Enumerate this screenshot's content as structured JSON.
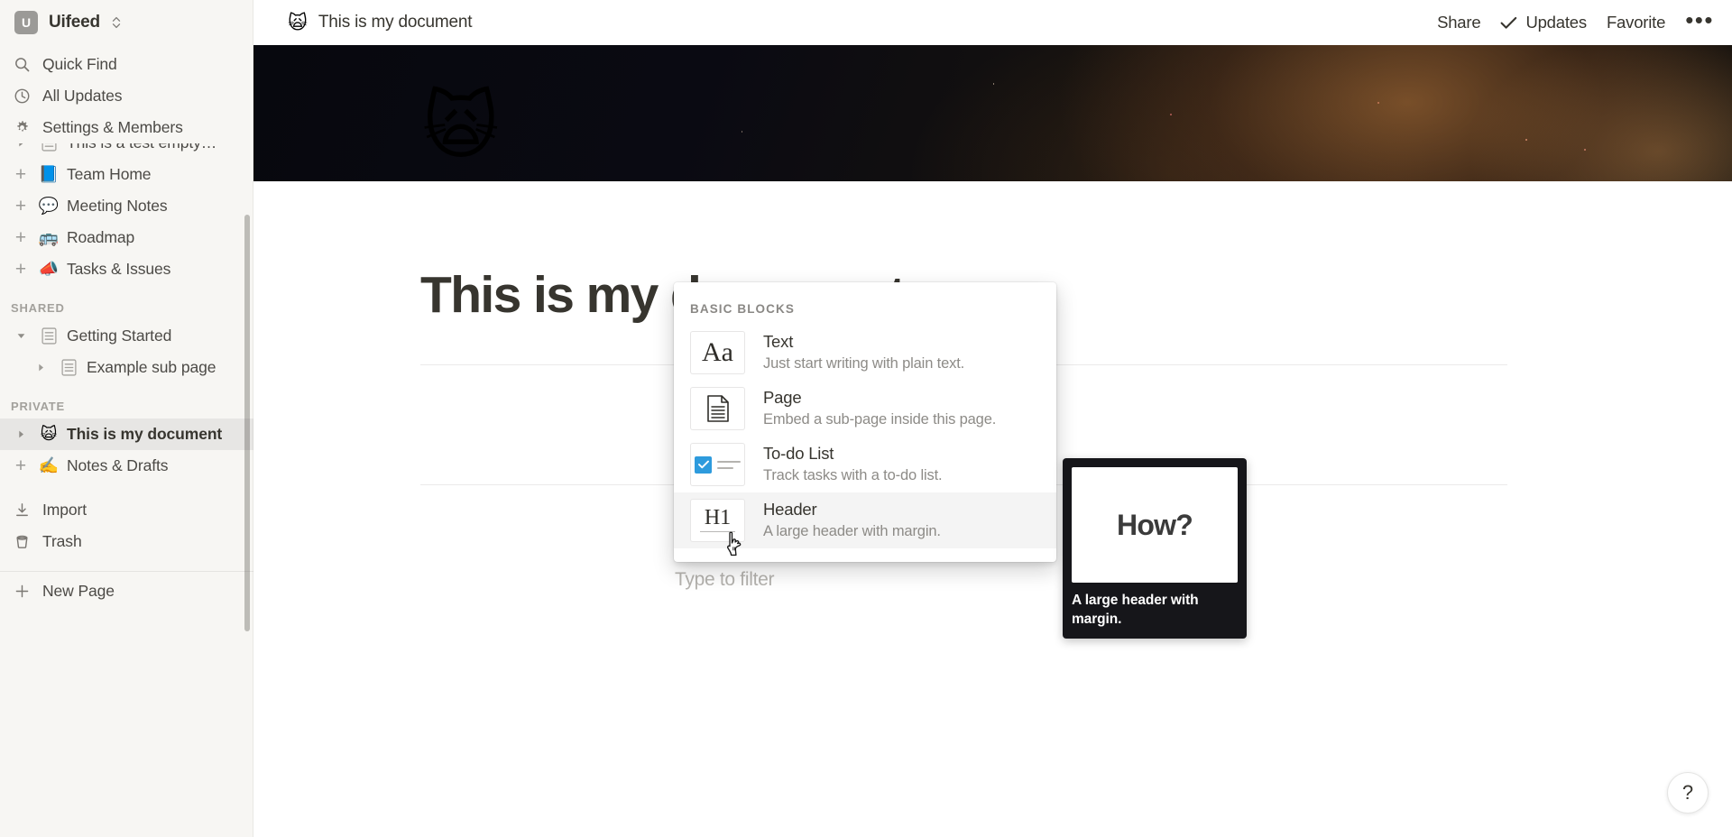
{
  "workspace": {
    "avatar_letter": "U",
    "name": "Uifeed",
    "switcher_icon": "chevron-updown-icon"
  },
  "sidebar": {
    "nav": [
      {
        "icon": "search-icon",
        "label": "Quick Find"
      },
      {
        "icon": "clock-icon",
        "label": "All Updates"
      },
      {
        "icon": "gear-icon",
        "label": "Settings & Members"
      }
    ],
    "tree": [
      {
        "type": "page",
        "toggle": "triangle-right",
        "icon_kind": "doc",
        "emoji": "",
        "label": "This is a test empty…",
        "selected": false,
        "clipped": true
      },
      {
        "type": "page",
        "toggle": "plus",
        "icon_kind": "emoji",
        "emoji": "📘",
        "label": "Team Home",
        "selected": false
      },
      {
        "type": "page",
        "toggle": "plus",
        "icon_kind": "emoji",
        "emoji": "💬",
        "label": "Meeting Notes",
        "selected": false
      },
      {
        "type": "page",
        "toggle": "plus",
        "icon_kind": "emoji",
        "emoji": "🚌",
        "label": "Roadmap",
        "selected": false
      },
      {
        "type": "page",
        "toggle": "plus",
        "icon_kind": "emoji",
        "emoji": "📣",
        "label": "Tasks & Issues",
        "selected": false
      }
    ],
    "section_shared": "SHARED",
    "shared": [
      {
        "toggle": "triangle-down",
        "icon_kind": "doc",
        "label": "Getting Started",
        "indent": 0,
        "selected": false
      },
      {
        "toggle": "triangle-right",
        "icon_kind": "doc",
        "label": "Example sub page",
        "indent": 1,
        "selected": false
      }
    ],
    "section_private": "PRIVATE",
    "private": [
      {
        "toggle": "triangle-right",
        "icon_kind": "emoji",
        "emoji": "🙀",
        "label": "This is my document",
        "indent": 0,
        "selected": true
      },
      {
        "toggle": "plus",
        "icon_kind": "emoji",
        "emoji": "✍️",
        "label": "Notes & Drafts",
        "indent": 0,
        "selected": false
      }
    ],
    "utilities": [
      {
        "icon": "download-icon",
        "label": "Import"
      },
      {
        "icon": "trash-icon",
        "label": "Trash"
      }
    ],
    "new_page": {
      "icon": "plus-icon",
      "label": "New Page"
    }
  },
  "topbar": {
    "page_emoji": "🙀",
    "page_title": "This is my document",
    "share_label": "Share",
    "updates_label": "Updates",
    "updates_icon": "check-icon",
    "favorite_label": "Favorite",
    "more_icon": "ellipsis-icon"
  },
  "document": {
    "title": "This is my document",
    "cover_alt": "space-nebula-cover",
    "page_icon": "🙀"
  },
  "block_menu": {
    "section_label": "BASIC BLOCKS",
    "filter_placeholder": "Type to filter",
    "items": [
      {
        "id": "text",
        "thumb": "aa-serif-icon",
        "name": "Text",
        "description": "Just start writing with plain text.",
        "hovered": false
      },
      {
        "id": "page",
        "thumb": "page-document-icon",
        "name": "Page",
        "description": "Embed a sub-page inside this page.",
        "hovered": false
      },
      {
        "id": "todo-list",
        "thumb": "checkbox-list-icon",
        "name": "To-do List",
        "description": "Track tasks with a to-do list.",
        "hovered": false
      },
      {
        "id": "header",
        "thumb": "h1-icon",
        "thumb_label": "H1",
        "name": "Header",
        "description": "A large header with margin.",
        "hovered": true
      }
    ]
  },
  "tooltip": {
    "preview_text": "How?",
    "caption": "A large header with margin."
  },
  "help": {
    "icon": "question-mark-icon",
    "label": "?"
  },
  "colors": {
    "sidebar_bg": "#f7f6f3",
    "text_primary": "#37352f",
    "text_secondary": "#8d8b87",
    "accent_checkbox": "#2e9bdd",
    "tooltip_bg": "#16161a"
  }
}
